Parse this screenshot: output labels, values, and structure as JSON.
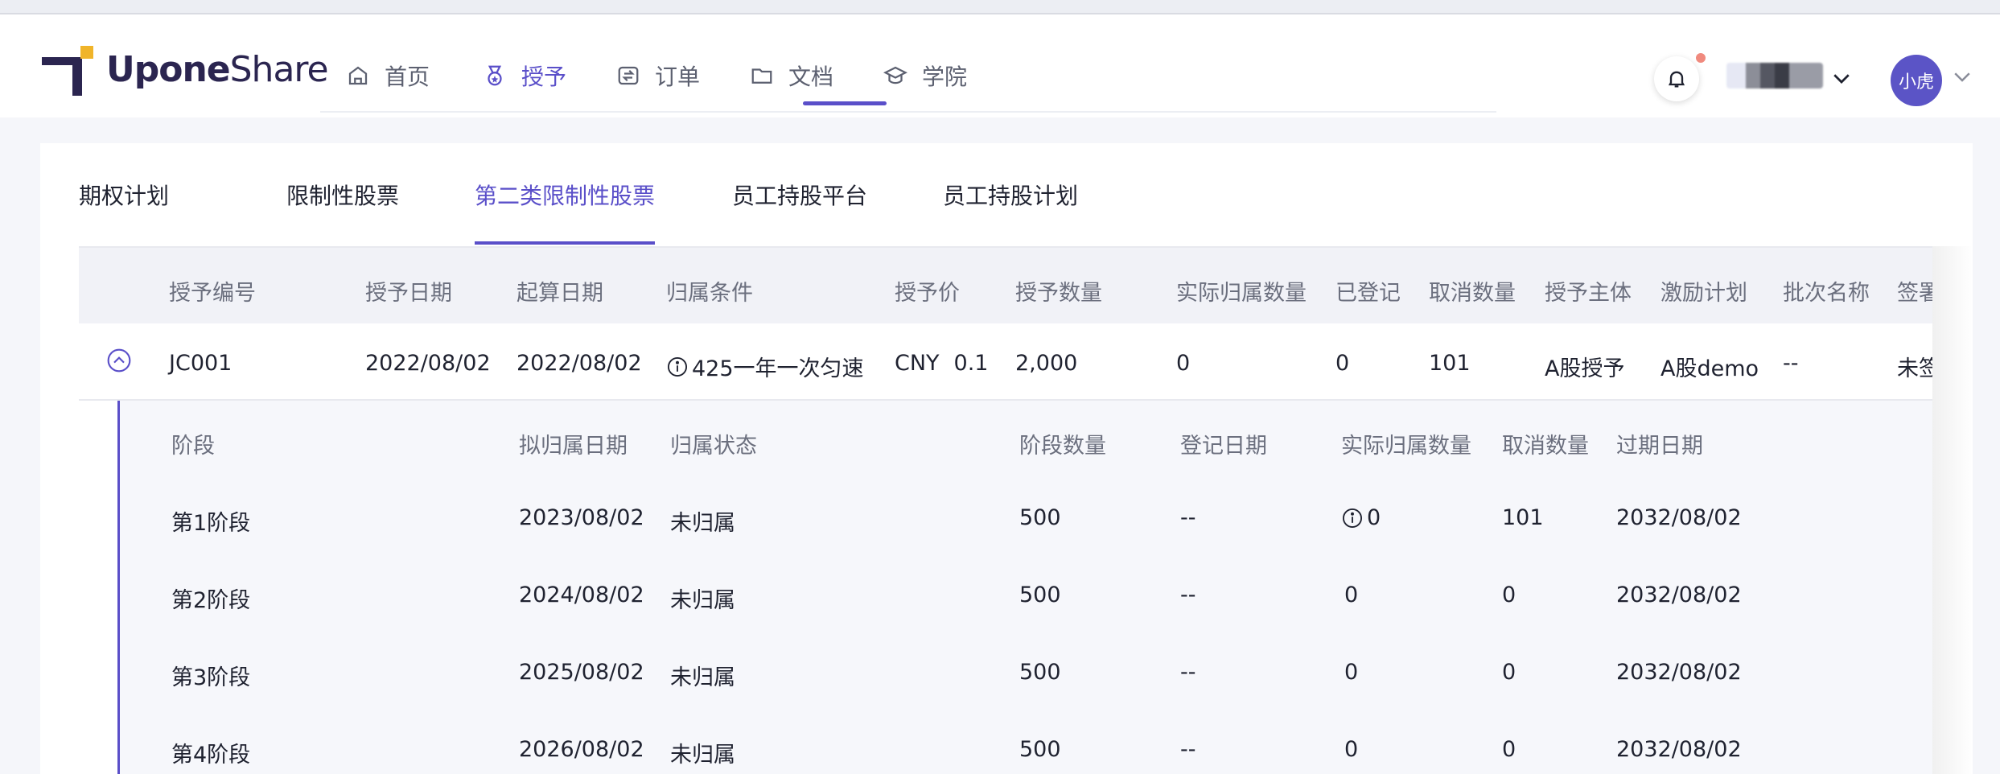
{
  "brand": {
    "name_left": "Upone",
    "name_right": "Share"
  },
  "nav": {
    "items": [
      {
        "label": "首页",
        "icon": "home-icon"
      },
      {
        "label": "授予",
        "icon": "medal-icon"
      },
      {
        "label": "订单",
        "icon": "swap-icon"
      },
      {
        "label": "文档",
        "icon": "folder-icon"
      },
      {
        "label": "学院",
        "icon": "graduation-cap-icon"
      }
    ],
    "active": "授予"
  },
  "user": {
    "avatar_text": "小虎"
  },
  "tabs": {
    "items": [
      "期权计划",
      "限制性股票",
      "第二类限制性股票",
      "员工持股平台",
      "员工持股计划"
    ],
    "active": "第二类限制性股票"
  },
  "grant_table": {
    "columns": [
      "授予编号",
      "授予日期",
      "起算日期",
      "归属条件",
      "授予价",
      "授予数量",
      "实际归属数量",
      "已登记",
      "取消数量",
      "授予主体",
      "激励计划",
      "批次名称",
      "签署"
    ],
    "row": {
      "grant_no": "JC001",
      "grant_date": "2022/08/02",
      "start_date": "2022/08/02",
      "vesting_condition": "425一年一次匀速",
      "price_currency": "CNY",
      "price_value": "0.1",
      "grant_qty": "2,000",
      "actual_vested": "0",
      "registered": "0",
      "cancelled": "101",
      "grant_entity": "A股授予",
      "plan": "A股demo",
      "batch": "--",
      "sign_status": "未签"
    }
  },
  "stage_table": {
    "columns": [
      "阶段",
      "拟归属日期",
      "归属状态",
      "阶段数量",
      "登记日期",
      "实际归属数量",
      "取消数量",
      "过期日期"
    ],
    "rows": [
      {
        "stage": "第1阶段",
        "planned_date": "2023/08/02",
        "status": "未归属",
        "qty": "500",
        "reg_date": "--",
        "actual": "0",
        "cancelled": "101",
        "expiry": "2032/08/02"
      },
      {
        "stage": "第2阶段",
        "planned_date": "2024/08/02",
        "status": "未归属",
        "qty": "500",
        "reg_date": "--",
        "actual": "0",
        "cancelled": "0",
        "expiry": "2032/08/02"
      },
      {
        "stage": "第3阶段",
        "planned_date": "2025/08/02",
        "status": "未归属",
        "qty": "500",
        "reg_date": "--",
        "actual": "0",
        "cancelled": "0",
        "expiry": "2032/08/02"
      },
      {
        "stage": "第4阶段",
        "planned_date": "2026/08/02",
        "status": "未归属",
        "qty": "500",
        "reg_date": "--",
        "actual": "0",
        "cancelled": "0",
        "expiry": "2032/08/02"
      }
    ]
  },
  "colors": {
    "accent": "#5a4fc9",
    "brand_dark": "#2b2550",
    "brand_yellow": "#f0b429",
    "notification": "#f08a7e"
  }
}
